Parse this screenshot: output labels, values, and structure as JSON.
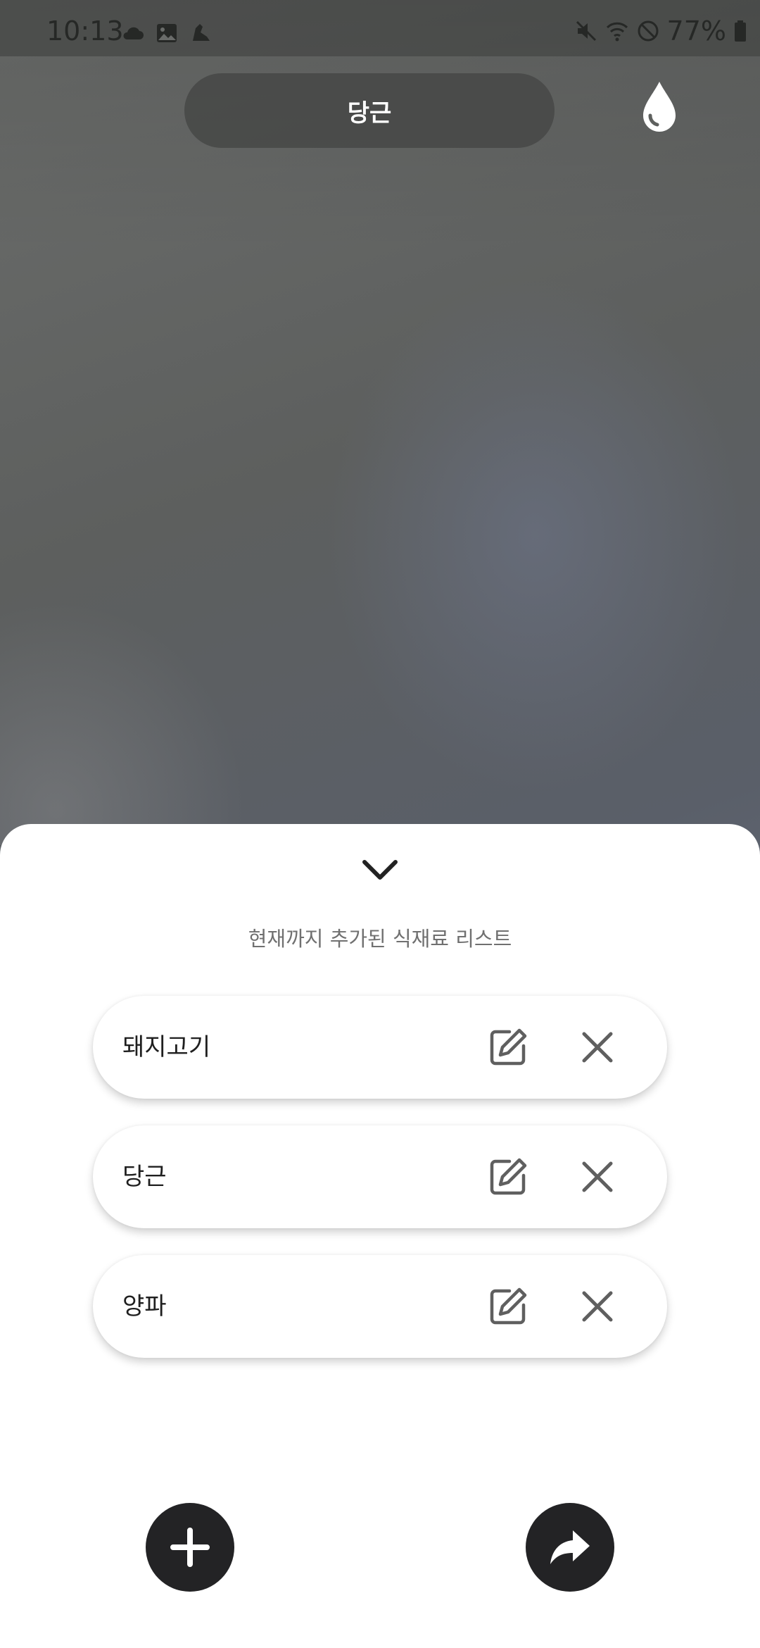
{
  "status_bar": {
    "time": "10:13",
    "battery": "77%",
    "left_icons": [
      "cloud-icon",
      "image-icon",
      "shoe-icon"
    ],
    "right_icons": [
      "mute-icon",
      "wifi-icon",
      "block-icon",
      "battery-icon"
    ]
  },
  "top": {
    "selected_ingredient": "당근",
    "drop_icon": "water-drop-icon"
  },
  "sheet": {
    "collapse_icon": "chevron-down-icon",
    "title": "현재까지 추가된 식재료 리스트",
    "items": [
      {
        "label": "돼지고기"
      },
      {
        "label": "당근"
      },
      {
        "label": "양파"
      }
    ],
    "add_icon": "plus-icon",
    "next_icon": "share-forward-icon"
  },
  "colors": {
    "sheet_bg": "#ffffff",
    "fab_bg": "#232325",
    "pill_bg": "#464846",
    "icon_gray": "#5f5f5f"
  }
}
